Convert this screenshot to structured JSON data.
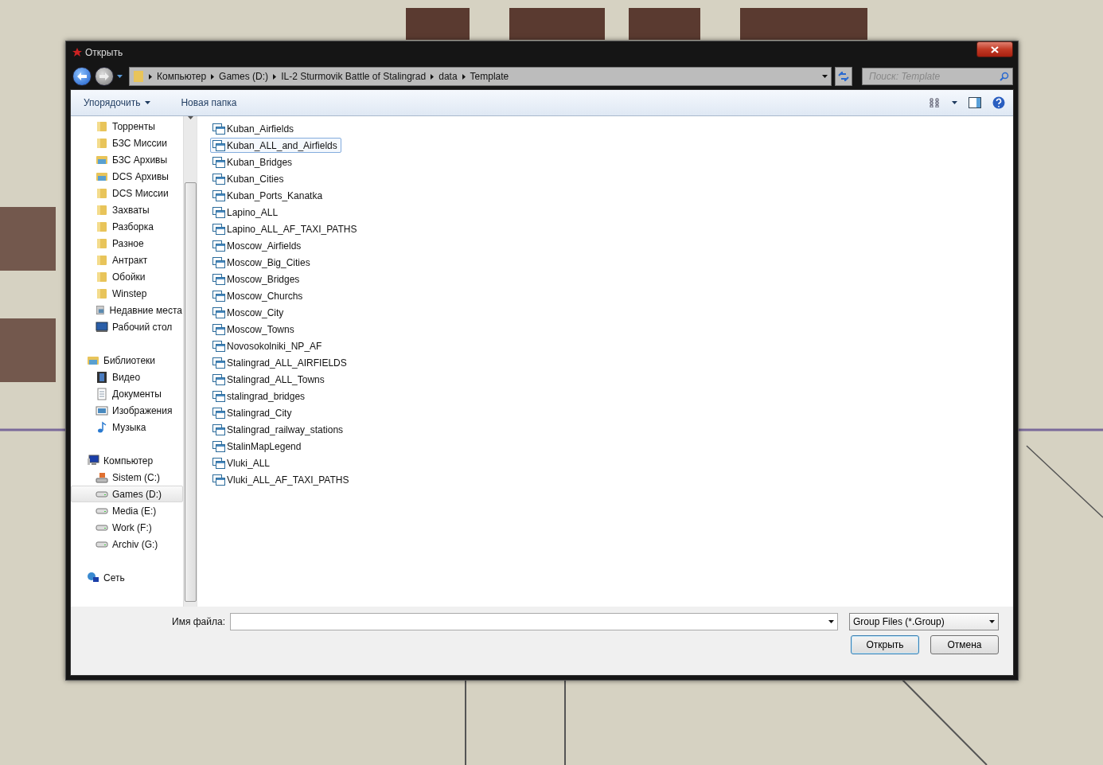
{
  "window": {
    "title": "Открыть"
  },
  "address": {
    "crumbs": [
      "Компьютер",
      "Games (D:)",
      "IL-2 Sturmovik Battle of Stalingrad",
      "data",
      "Template"
    ]
  },
  "search": {
    "placeholder": "Поиск: Template"
  },
  "toolbar": {
    "items": [
      {
        "label": "Упорядочить",
        "dropdown": true
      },
      {
        "label": "Новая папка",
        "dropdown": false
      }
    ]
  },
  "navigation": [
    {
      "children": [
        {
          "label": "Торренты",
          "kind": "folder",
          "selected": false
        },
        {
          "label": "БЗС Миссии",
          "kind": "folder",
          "selected": false
        },
        {
          "label": "БЗС Архивы",
          "kind": "library",
          "selected": false
        },
        {
          "label": "DCS Архивы",
          "kind": "library",
          "selected": false
        },
        {
          "label": "DCS Миссии",
          "kind": "folder",
          "selected": false
        },
        {
          "label": "Захваты",
          "kind": "folder",
          "selected": false
        },
        {
          "label": "Разборка",
          "kind": "folder",
          "selected": false
        },
        {
          "label": "Разное",
          "kind": "folder",
          "selected": false
        },
        {
          "label": "Антракт",
          "kind": "folder",
          "selected": false
        },
        {
          "label": "Обойки",
          "kind": "folder",
          "selected": false
        },
        {
          "label": "Winstep",
          "kind": "folder",
          "selected": false
        },
        {
          "label": "Недавние места",
          "kind": "recent",
          "selected": false
        },
        {
          "label": "Рабочий стол",
          "kind": "desktop",
          "selected": false
        }
      ]
    },
    {
      "label": "Библиотеки",
      "kind": "library",
      "selected": false,
      "children": [
        {
          "label": "Видео",
          "kind": "video",
          "selected": false
        },
        {
          "label": "Документы",
          "kind": "document",
          "selected": false
        },
        {
          "label": "Изображения",
          "kind": "image",
          "selected": false
        },
        {
          "label": "Музыка",
          "kind": "music",
          "selected": false
        }
      ]
    },
    {
      "label": "Компьютер",
      "kind": "computer",
      "selected": false,
      "children": [
        {
          "label": "Sistem (C:)",
          "kind": "system-drive",
          "selected": false
        },
        {
          "label": "Games (D:)",
          "kind": "drive",
          "selected": true
        },
        {
          "label": "Media (E:)",
          "kind": "drive",
          "selected": false
        },
        {
          "label": "Work (F:)",
          "kind": "drive",
          "selected": false
        },
        {
          "label": "Archiv (G:)",
          "kind": "drive",
          "selected": false
        }
      ]
    },
    {
      "label": "Сеть",
      "kind": "network",
      "selected": false
    }
  ],
  "files": [
    {
      "name": "Kuban_Airfields",
      "selected": false
    },
    {
      "name": "Kuban_ALL_and_Airfields",
      "selected": true
    },
    {
      "name": "Kuban_Bridges",
      "selected": false
    },
    {
      "name": "Kuban_Cities",
      "selected": false
    },
    {
      "name": "Kuban_Ports_Kanatka",
      "selected": false
    },
    {
      "name": "Lapino_ALL",
      "selected": false
    },
    {
      "name": "Lapino_ALL_AF_TAXI_PATHS",
      "selected": false
    },
    {
      "name": "Moscow_Airfields",
      "selected": false
    },
    {
      "name": "Moscow_Big_Cities",
      "selected": false
    },
    {
      "name": "Moscow_Bridges",
      "selected": false
    },
    {
      "name": "Moscow_Churchs",
      "selected": false
    },
    {
      "name": "Moscow_City",
      "selected": false
    },
    {
      "name": "Moscow_Towns",
      "selected": false
    },
    {
      "name": "Novosokolniki_NP_AF",
      "selected": false
    },
    {
      "name": "Stalingrad_ALL_AIRFIELDS",
      "selected": false
    },
    {
      "name": "Stalingrad_ALL_Towns",
      "selected": false
    },
    {
      "name": "stalingrad_bridges",
      "selected": false
    },
    {
      "name": "Stalingrad_City",
      "selected": false
    },
    {
      "name": "Stalingrad_railway_stations",
      "selected": false
    },
    {
      "name": "StalinMapLegend",
      "selected": false
    },
    {
      "name": "Vluki_ALL",
      "selected": false
    },
    {
      "name": "Vluki_ALL_AF_TAXI_PATHS",
      "selected": false
    }
  ],
  "footer": {
    "filename_label": "Имя файла:",
    "filter": "Group Files (*.Group)",
    "buttons": [
      {
        "label": "Открыть",
        "kind": "primary"
      },
      {
        "label": "Отмена",
        "kind": "secondary"
      }
    ]
  }
}
